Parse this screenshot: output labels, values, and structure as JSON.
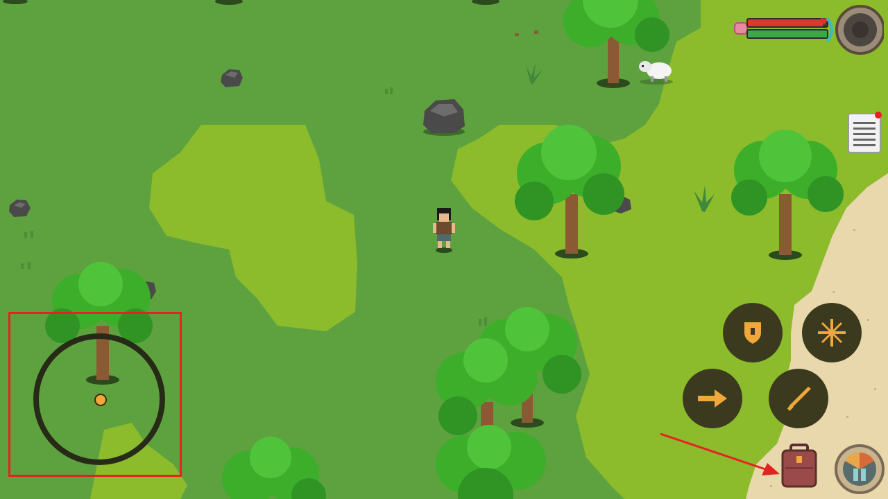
{
  "colors": {
    "dark_grass": "#5ea23f",
    "light_grass": "#8cbb2c",
    "sand": "#e8d8ab",
    "health": "#d83a2b",
    "stamina": "#3aa84a",
    "button_bg": "#3b3a1f",
    "button_icon": "#f0a83a",
    "annotation_red": "#e52222",
    "notification_dot": "#e52222"
  },
  "hud": {
    "health": 0.95,
    "stamina": 1.0,
    "player_icon": "pig-icon",
    "compass_icon": "compass-icon",
    "note_icon": "notes-icon",
    "note_has_notification": true,
    "action_buttons": [
      {
        "name": "shield-button",
        "icon": "shield-icon"
      },
      {
        "name": "sparkle-button",
        "icon": "sparkle-icon"
      },
      {
        "name": "dash-button",
        "icon": "arrow-right-icon"
      },
      {
        "name": "attack-button",
        "icon": "sword-icon"
      }
    ],
    "inventory_icon": "backpack-icon",
    "crafting_icon": "crafting-wheel-icon"
  },
  "controls": {
    "joystick_icon": "virtual-joystick"
  },
  "annotations": {
    "highlight_target": "virtual-joystick",
    "arrow_target": "backpack-button"
  }
}
